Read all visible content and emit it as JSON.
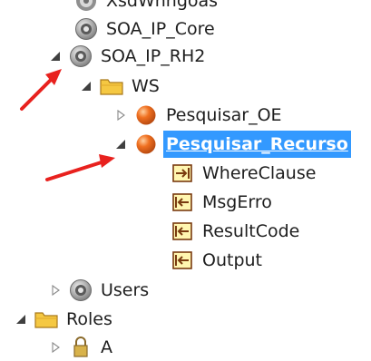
{
  "tree": {
    "partial_top": "XsdWhngoas",
    "nodes": [
      {
        "id": "soa-ip-core",
        "label": "SOA_IP_Core",
        "icon": "disc-icon",
        "toggle": "none",
        "selected": false
      },
      {
        "id": "soa-ip-rh2",
        "label": "SOA_IP_RH2",
        "icon": "disc-icon",
        "toggle": "expanded",
        "selected": false
      },
      {
        "id": "ws",
        "label": "WS",
        "icon": "folder-icon",
        "toggle": "expanded",
        "selected": false
      },
      {
        "id": "pesquisar-oe",
        "label": "Pesquisar_OE",
        "icon": "orange-ball-icon",
        "toggle": "collapsed",
        "selected": false
      },
      {
        "id": "pesquisar-recurso",
        "label": "Pesquisar_Recurso",
        "icon": "orange-ball-icon",
        "toggle": "expanded",
        "selected": true
      },
      {
        "id": "whereclause",
        "label": "WhereClause",
        "icon": "input-arrow-icon",
        "toggle": "none",
        "selected": false
      },
      {
        "id": "msgerro",
        "label": "MsgErro",
        "icon": "output-arrow-icon",
        "toggle": "none",
        "selected": false
      },
      {
        "id": "resultcode",
        "label": "ResultCode",
        "icon": "output-arrow-icon",
        "toggle": "none",
        "selected": false
      },
      {
        "id": "output",
        "label": "Output",
        "icon": "output-arrow-icon",
        "toggle": "none",
        "selected": false
      },
      {
        "id": "users",
        "label": "Users",
        "icon": "disc-icon",
        "toggle": "collapsed",
        "selected": false
      },
      {
        "id": "roles",
        "label": "Roles",
        "icon": "folder-icon",
        "toggle": "expanded",
        "selected": false
      },
      {
        "id": "roles-child",
        "label": "A",
        "icon": "lock-icon",
        "toggle": "collapsed",
        "selected": false
      }
    ]
  },
  "colors": {
    "selection": "#3399ff",
    "annotation_arrow": "#e8211e",
    "folder": "#f5c842",
    "orange_ball": "#f07020",
    "param_icon_border": "#7a3b10"
  }
}
